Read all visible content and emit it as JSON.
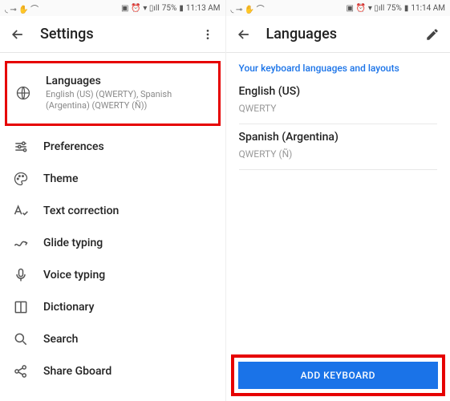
{
  "status": {
    "left_icons": "◟ ⊸ ✋ ⌒",
    "battery_pct": "75%",
    "time_left": "11:13 AM",
    "time_right": "11:14 AM"
  },
  "left": {
    "title": "Settings",
    "items": [
      {
        "icon": "globe",
        "title": "Languages",
        "sub": "English (US) (QWERTY), Spanish (Argentina) (QWERTY (Ñ))"
      },
      {
        "icon": "sliders",
        "title": "Preferences"
      },
      {
        "icon": "palette",
        "title": "Theme"
      },
      {
        "icon": "textcheck",
        "title": "Text correction"
      },
      {
        "icon": "glide",
        "title": "Glide typing"
      },
      {
        "icon": "mic",
        "title": "Voice typing"
      },
      {
        "icon": "book",
        "title": "Dictionary"
      },
      {
        "icon": "search",
        "title": "Search"
      },
      {
        "icon": "share",
        "title": "Share Gboard"
      }
    ]
  },
  "right": {
    "title": "Languages",
    "section_header": "Your keyboard languages and layouts",
    "langs": [
      {
        "name": "English (US)",
        "layout": "QWERTY"
      },
      {
        "name": "Spanish (Argentina)",
        "layout": "QWERTY (Ñ)"
      }
    ],
    "add_button": "ADD KEYBOARD"
  }
}
